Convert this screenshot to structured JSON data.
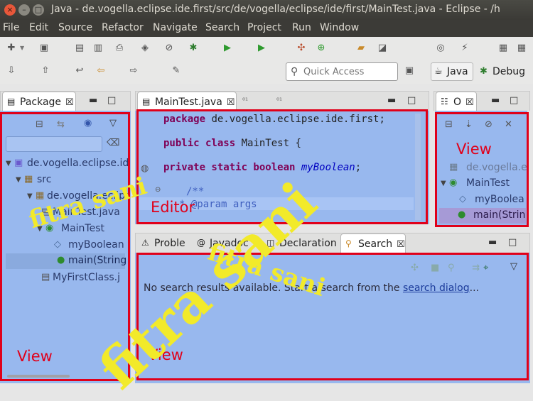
{
  "window": {
    "title": "Java - de.vogella.eclipse.ide.first/src/de/vogella/eclipse/ide/first/MainTest.java - Eclipse - /h"
  },
  "menu": [
    "File",
    "Edit",
    "Source",
    "Refactor",
    "Navigate",
    "Search",
    "Project",
    "Run",
    "Window"
  ],
  "quick_access": {
    "placeholder": "Quick Access"
  },
  "perspectives": {
    "java": "Java",
    "debug": "Debug"
  },
  "package_explorer": {
    "tab_label": "Package",
    "close": "☒",
    "tree": [
      {
        "label": "de.vogella.eclipse.id",
        "icon": "project-icon"
      },
      {
        "label": "src",
        "icon": "source-folder-icon"
      },
      {
        "label": "de.vogella.eclips",
        "icon": "package-icon"
      },
      {
        "label": "MainTest.java",
        "icon": "java-file-icon"
      },
      {
        "label": "MainTest",
        "icon": "class-icon"
      },
      {
        "label": "myBoolean",
        "icon": "field-icon"
      },
      {
        "label": "main(String",
        "icon": "method-icon"
      },
      {
        "label": "MyFirstClass.j",
        "icon": "java-file-icon"
      }
    ]
  },
  "editor": {
    "tab_label": "MainTest.java",
    "code": {
      "line1_kw": "package",
      "line1_rest": " de.vogella.eclipse.ide.first;",
      "line2_kw": "public class",
      "line2_rest": " MainTest {",
      "line3_kw": "private static boolean",
      "line3_field": "myBoolean",
      "line3_end": ";",
      "line4": "/**",
      "line5": " * @param args"
    }
  },
  "outline": {
    "tab_label": "O",
    "tree": [
      {
        "label": "de.vogella.e",
        "icon": "package-decl-icon"
      },
      {
        "label": "MainTest",
        "icon": "class-icon"
      },
      {
        "label": "myBoolea",
        "icon": "field-icon"
      },
      {
        "label": "main(Strin",
        "icon": "method-icon"
      }
    ]
  },
  "bottom_panel": {
    "tabs": {
      "problems": "Proble",
      "javadoc": "Javadoc",
      "declaration": "Declaration",
      "search": "Search"
    },
    "message_prefix": "No search results available. Start a search from the ",
    "message_link": "search dialog",
    "message_suffix": "..."
  },
  "annotations": {
    "view_left": "View",
    "editor": "Editor",
    "view_outline": "View",
    "view_bottom": "View"
  },
  "watermark": {
    "big": "fitra sani",
    "small1": "fitra sani",
    "small2": "fitra sani"
  },
  "colors": {
    "highlight_blue": "#98b8ee",
    "annotation_red": "#e0001a",
    "watermark_yellow": "#f2ea2a",
    "menubar_dark": "#3c3b37"
  }
}
